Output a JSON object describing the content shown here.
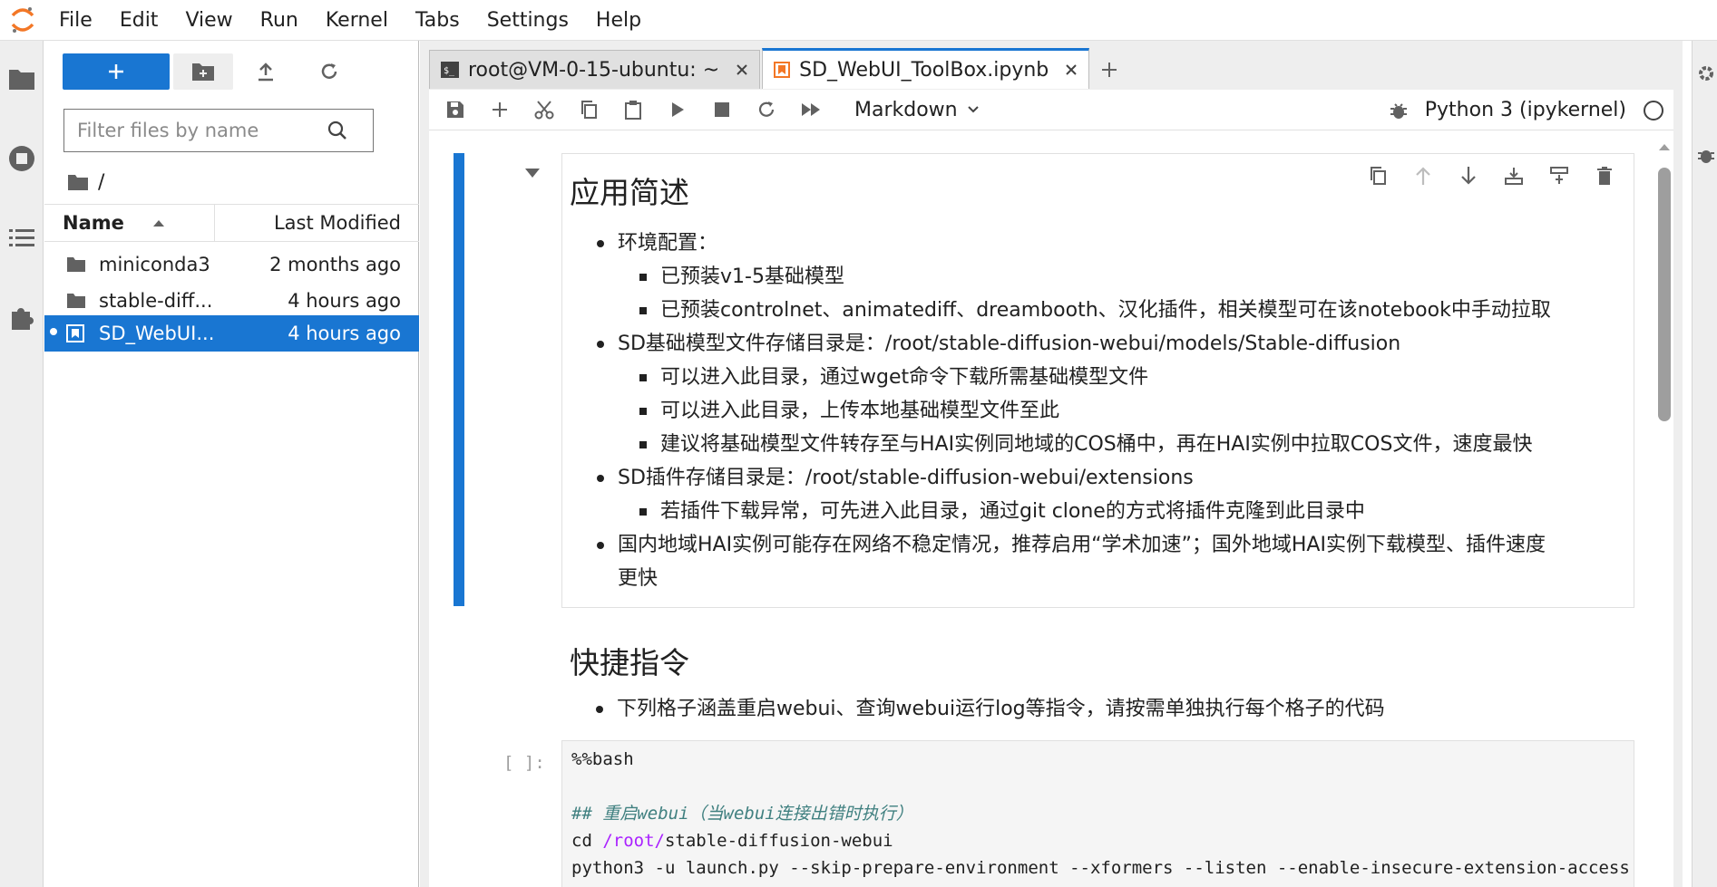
{
  "menu": [
    "File",
    "Edit",
    "View",
    "Run",
    "Kernel",
    "Tabs",
    "Settings",
    "Help"
  ],
  "file_browser": {
    "filter_placeholder": "Filter files by name",
    "breadcrumb": "/",
    "columns": {
      "name": "Name",
      "modified": "Last Modified"
    },
    "files": [
      {
        "name": "miniconda3",
        "modified": "2 months ago",
        "icon": "folder-icon"
      },
      {
        "name": "stable-diff...",
        "modified": "4 hours ago",
        "icon": "folder-icon"
      },
      {
        "name": "SD_WebUI...",
        "modified": "4 hours ago",
        "icon": "notebook-icon",
        "selected": true
      }
    ]
  },
  "tabs": [
    {
      "label": "root@VM-0-15-ubuntu: ~",
      "icon": "terminal-icon"
    },
    {
      "label": "SD_WebUI_ToolBox.ipynb",
      "icon": "notebook-icon",
      "active": true
    }
  ],
  "toolbar": {
    "cell_type": "Markdown",
    "kernel_name": "Python 3 (ipykernel)"
  },
  "notebook": {
    "h1_app": "应用简述",
    "env_config": "环境配置：",
    "env_items": [
      "已预装v1-5基础模型",
      "已预装controlnet、animatediff、dreambooth、汉化插件，相关模型可在该notebook中手动拉取"
    ],
    "model_dir": "SD基础模型文件存储目录是：/root/stable-diffusion-webui/models/Stable-diffusion",
    "model_items": [
      "可以进入此目录，通过wget命令下载所需基础模型文件",
      "可以进入此目录，上传本地基础模型文件至此",
      "建议将基础模型文件转存至与HAI实例同地域的COS桶中，再在HAI实例中拉取COS文件，速度最快"
    ],
    "ext_dir": "SD插件存储目录是：/root/stable-diffusion-webui/extensions",
    "ext_items": [
      "若插件下载异常，可先进入此目录，通过git clone的方式将插件克隆到此目录中"
    ],
    "network_line1": "国内地域HAI实例可能存在网络不稳定情况，推荐启用“学术加速”；国外地域HAI实例下载模型、插件速度",
    "network_line2": "更快",
    "h1_cmd": "快捷指令",
    "cmd_item": "下列格子涵盖重启webui、查询webui运行log等指令，请按需单独执行每个格子的代码",
    "prompt": "[ ]:",
    "code_line1": "%%bash",
    "code_comment": "## 重启webui（当webui连接出错时执行）",
    "code_cd": "cd ",
    "code_root": "/root/",
    "code_path_rest": "stable-diffusion-webui",
    "code_line4": "python3 -u launch.py --skip-prepare-environment --xformers --listen --enable-insecure-extension-access"
  },
  "colors": {
    "accent": "#1976d2",
    "jupyter_orange": "#f37726"
  }
}
